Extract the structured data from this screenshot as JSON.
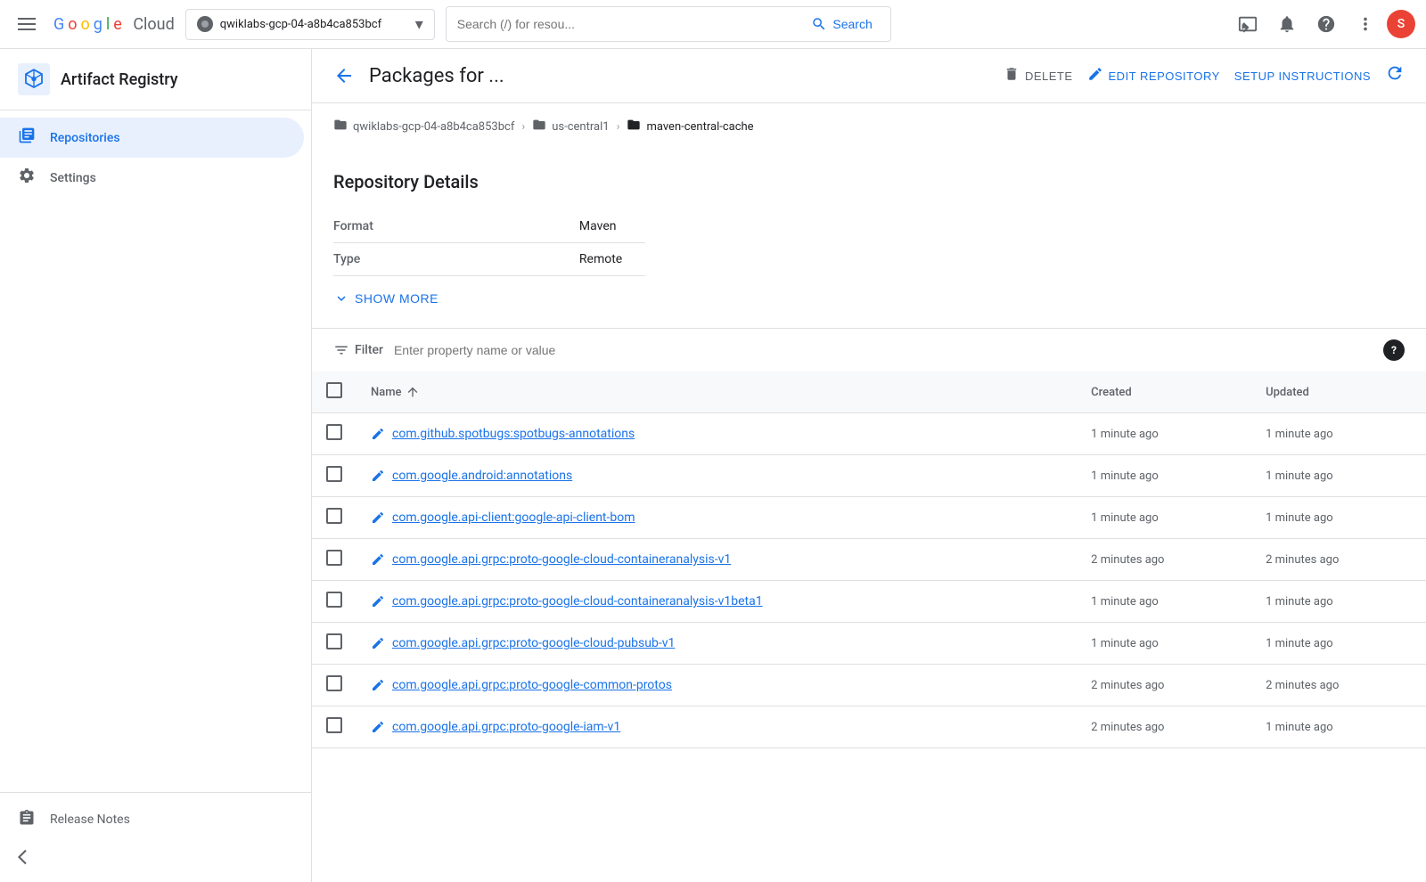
{
  "topnav": {
    "hamburger_label": "Menu",
    "google_logo": "Google Cloud",
    "project": {
      "name": "qwiklabs-gcp-04-a8b4ca853bcf",
      "dropdown_icon": "▾"
    },
    "search": {
      "placeholder": "Search (/) for resou...",
      "button_label": "Search"
    },
    "icons": {
      "terminal": "⬛",
      "notifications": "🔔",
      "help": "?",
      "more": "⋮"
    },
    "avatar": "S"
  },
  "sidebar": {
    "title": "Artifact Registry",
    "nav_items": [
      {
        "id": "repositories",
        "label": "Repositories",
        "active": true
      },
      {
        "id": "settings",
        "label": "Settings",
        "active": false
      }
    ],
    "bottom_items": [
      {
        "id": "release-notes",
        "label": "Release Notes"
      }
    ],
    "collapse_tooltip": "Collapse"
  },
  "header": {
    "back_tooltip": "Back",
    "title": "Packages for ...",
    "actions": {
      "delete": "DELETE",
      "edit_repository": "EDIT REPOSITORY",
      "setup_instructions": "SETUP INSTRUCTIONS"
    }
  },
  "breadcrumb": {
    "items": [
      {
        "label": "qwiklabs-gcp-04-a8b4ca853bcf",
        "type": "folder"
      },
      {
        "label": "us-central1",
        "type": "folder"
      },
      {
        "label": "maven-central-cache",
        "type": "folder",
        "active": true
      }
    ]
  },
  "repo_details": {
    "title": "Repository Details",
    "rows": [
      {
        "label": "Format",
        "value": "Maven"
      },
      {
        "label": "Type",
        "value": "Remote"
      }
    ],
    "show_more_label": "SHOW MORE"
  },
  "filter": {
    "label": "Filter",
    "placeholder": "Enter property name or value"
  },
  "table": {
    "columns": {
      "name": "Name",
      "created": "Created",
      "updated": "Updated"
    },
    "rows": [
      {
        "name": "com.github.spotbugs:spotbugs-annotations",
        "created": "1 minute ago",
        "updated": "1 minute ago"
      },
      {
        "name": "com.google.android:annotations",
        "created": "1 minute ago",
        "updated": "1 minute ago"
      },
      {
        "name": "com.google.api-client:google-api-client-bom",
        "created": "1 minute ago",
        "updated": "1 minute ago"
      },
      {
        "name": "com.google.api.grpc:proto-google-cloud-containeranalysis-v1",
        "created": "2 minutes ago",
        "updated": "2 minutes ago"
      },
      {
        "name": "com.google.api.grpc:proto-google-cloud-containeranalysis-v1beta1",
        "created": "1 minute ago",
        "updated": "1 minute ago"
      },
      {
        "name": "com.google.api.grpc:proto-google-cloud-pubsub-v1",
        "created": "1 minute ago",
        "updated": "1 minute ago"
      },
      {
        "name": "com.google.api.grpc:proto-google-common-protos",
        "created": "2 minutes ago",
        "updated": "2 minutes ago"
      },
      {
        "name": "com.google.api.grpc:proto-google-iam-v1",
        "created": "2 minutes ago",
        "updated": "1 minute ago"
      }
    ]
  }
}
